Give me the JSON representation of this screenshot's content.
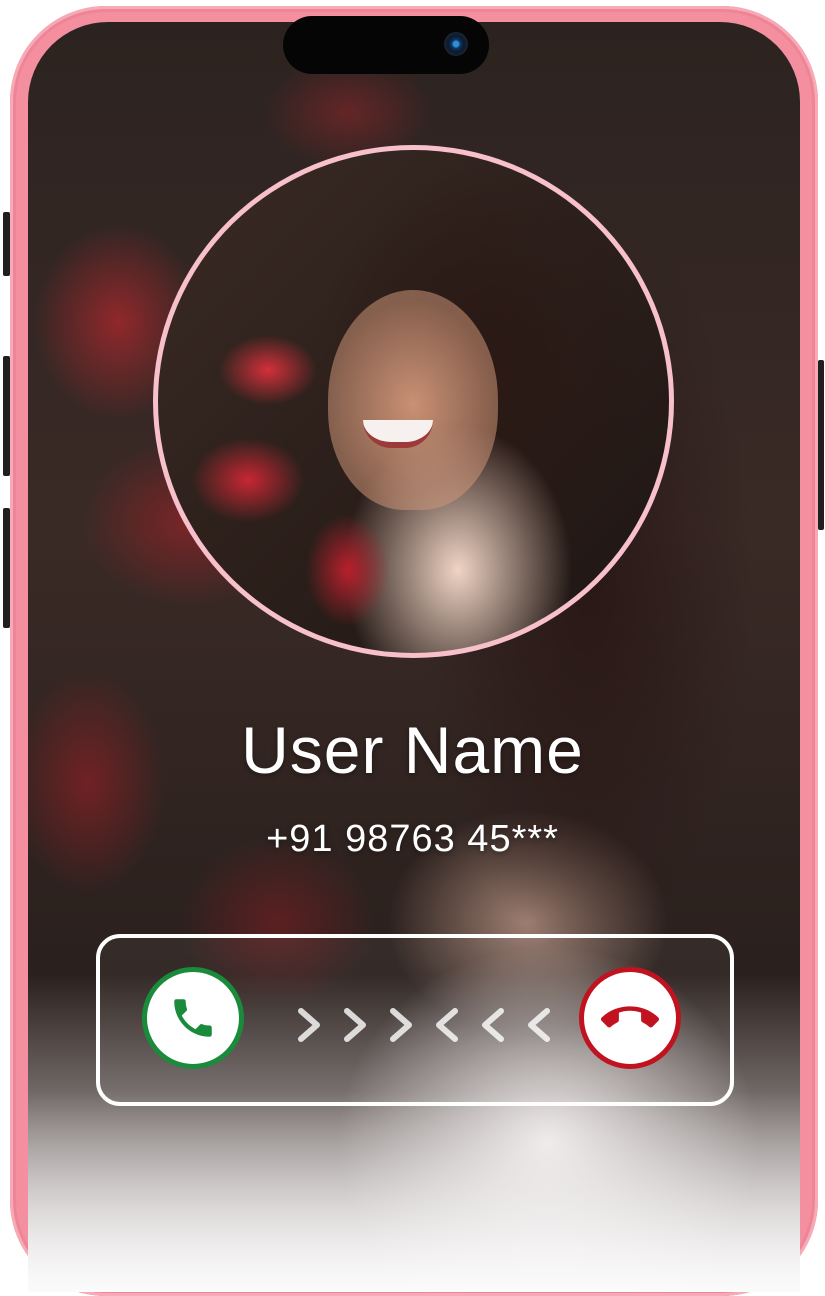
{
  "call": {
    "caller_name": "User Name",
    "caller_number": "+91 98763 45***"
  },
  "actions": {
    "accept_icon": "phone-icon",
    "decline_icon": "phone-hangup-icon",
    "swipe_hint_icons": [
      "chevron-right-icon",
      "chevron-right-icon",
      "chevron-right-icon",
      "chevron-left-icon",
      "chevron-left-icon",
      "chevron-left-icon"
    ]
  },
  "colors": {
    "frame": "#f48fa0",
    "avatar_ring": "#f7c0ca",
    "accept": "#1a8a3b",
    "decline": "#c1121f"
  }
}
